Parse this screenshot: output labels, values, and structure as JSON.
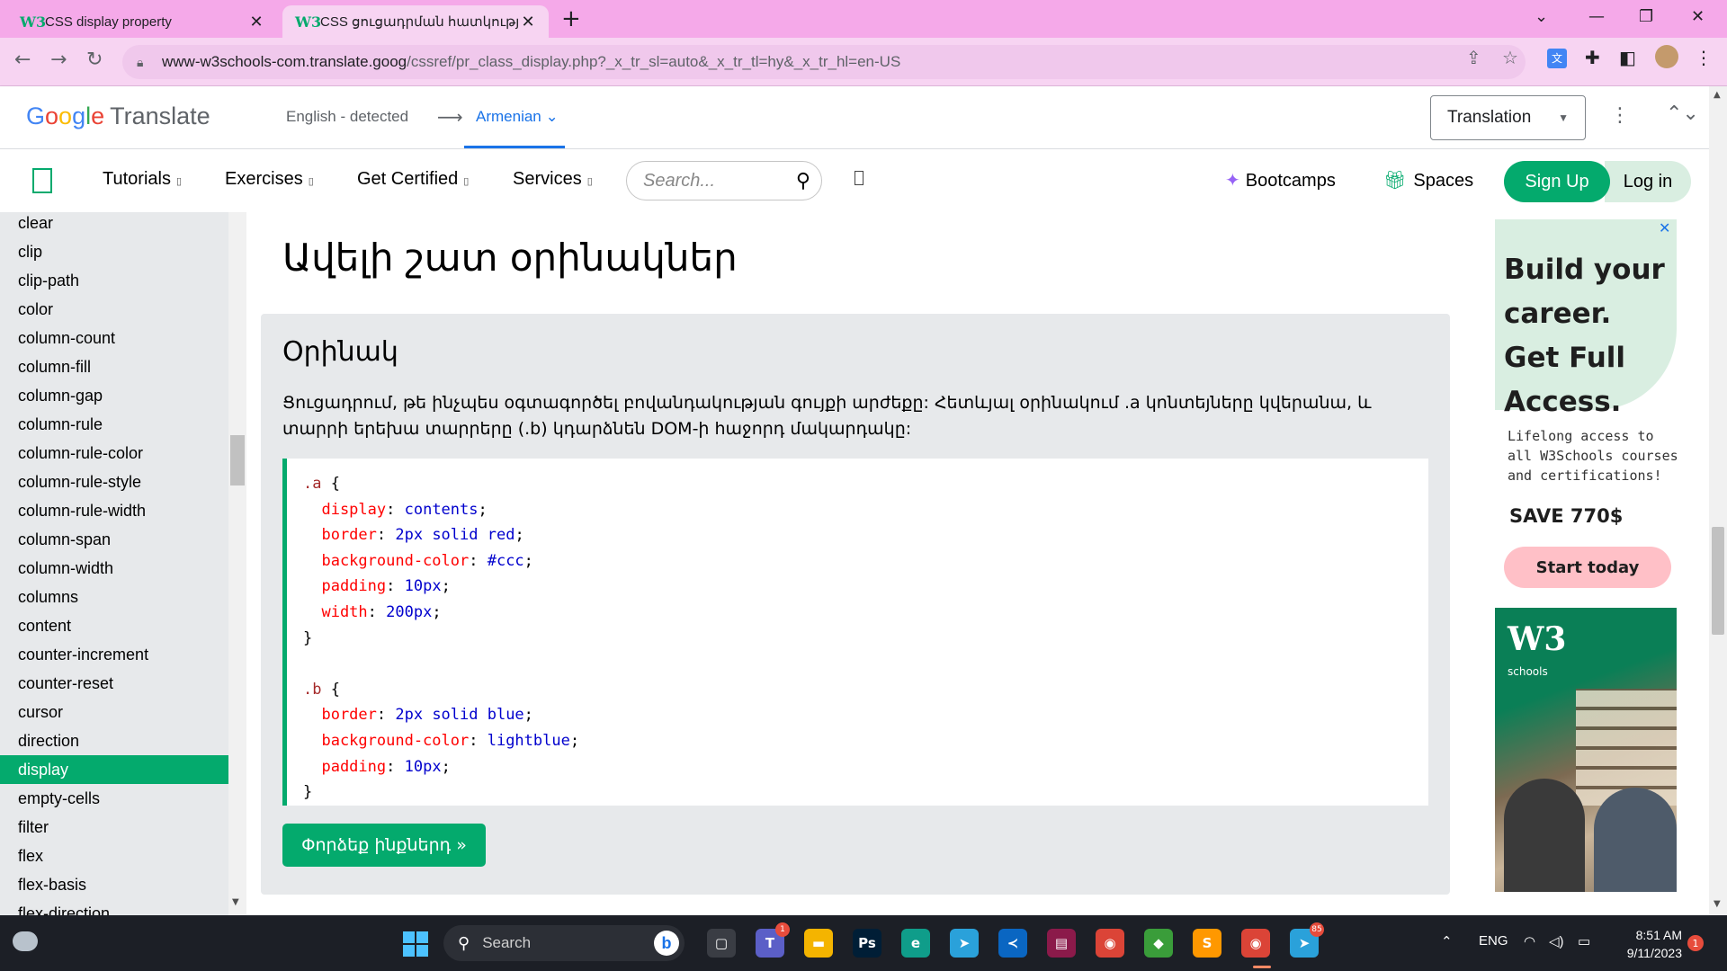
{
  "browser": {
    "tabs": [
      {
        "title": "CSS display property",
        "favicon": "W3",
        "active": false
      },
      {
        "title": "CSS ցուցադրման հատկություն",
        "favicon": "W3",
        "active": true
      }
    ],
    "new_tab": "+",
    "window_controls": {
      "dropdown": "⌄",
      "minimize": "—",
      "restore": "❐",
      "close": "✕"
    },
    "url_host": "www-w3schools-com.translate.goog",
    "url_path": "/cssref/pr_class_display.php?_x_tr_sl=auto&_x_tr_tl=hy&_x_tr_hl=en-US",
    "nav": {
      "back": "←",
      "forward": "→",
      "reload": "↻"
    }
  },
  "google_translate": {
    "logo": {
      "g1": "G",
      "g2": "o",
      "g3": "o",
      "g4": "g",
      "g5": "l",
      "g6": "e",
      "product": "Translate"
    },
    "source_language": "English - detected",
    "arrow": "⟶",
    "target_language": "Armenian ⌄",
    "mode_select": "Translation",
    "mode_caret": "▼",
    "more": "⋮",
    "close": "⌃⌄"
  },
  "w3nav": {
    "menu": [
      {
        "label": "Tutorials"
      },
      {
        "label": "Exercises"
      },
      {
        "label": "Get Certified"
      },
      {
        "label": "Services"
      }
    ],
    "menu_chevron": "▯",
    "search_placeholder": "Search...",
    "search_icon": "⚲",
    "bootcamps": "Bootcamps",
    "spaces": "Spaces",
    "sign_up": "Sign Up",
    "log_in": "Log in"
  },
  "sidebar": {
    "items": [
      {
        "label": "clear",
        "active": false
      },
      {
        "label": "clip",
        "active": false
      },
      {
        "label": "clip-path",
        "active": false
      },
      {
        "label": "color",
        "active": false
      },
      {
        "label": "column-count",
        "active": false
      },
      {
        "label": "column-fill",
        "active": false
      },
      {
        "label": "column-gap",
        "active": false
      },
      {
        "label": "column-rule",
        "active": false
      },
      {
        "label": "column-rule-color",
        "active": false
      },
      {
        "label": "column-rule-style",
        "active": false
      },
      {
        "label": "column-rule-width",
        "active": false
      },
      {
        "label": "column-span",
        "active": false
      },
      {
        "label": "column-width",
        "active": false
      },
      {
        "label": "columns",
        "active": false
      },
      {
        "label": "content",
        "active": false
      },
      {
        "label": "counter-increment",
        "active": false
      },
      {
        "label": "counter-reset",
        "active": false
      },
      {
        "label": "cursor",
        "active": false
      },
      {
        "label": "direction",
        "active": false
      },
      {
        "label": "display",
        "active": true
      },
      {
        "label": "empty-cells",
        "active": false
      },
      {
        "label": "filter",
        "active": false
      },
      {
        "label": "flex",
        "active": false
      },
      {
        "label": "flex-basis",
        "active": false
      },
      {
        "label": "flex-direction",
        "active": false
      }
    ]
  },
  "main": {
    "heading": "Ավելի շատ օրինակներ",
    "example": {
      "title": "Օրինակ",
      "description": "Ցուցադրում, թե ինչպես օգտագործել բովանդակության գույքի արժեքը: Հետևյալ օրինակում .a կոնտեյները կվերանա, և տարրի երեխա տարրերը (.b) կդարձնեն DOM-ի հաջորդ մակարդակը:",
      "code": [
        [
          {
            "t": ".a",
            "c": "sel"
          },
          {
            "t": " {",
            "c": "plain"
          }
        ],
        [
          {
            "t": "  display",
            "c": "prop"
          },
          {
            "t": ": ",
            "c": "plain"
          },
          {
            "t": "contents",
            "c": "val"
          },
          {
            "t": ";",
            "c": "plain"
          }
        ],
        [
          {
            "t": "  border",
            "c": "prop"
          },
          {
            "t": ": ",
            "c": "plain"
          },
          {
            "t": "2px solid red",
            "c": "val"
          },
          {
            "t": ";",
            "c": "plain"
          }
        ],
        [
          {
            "t": "  background-color",
            "c": "prop"
          },
          {
            "t": ": ",
            "c": "plain"
          },
          {
            "t": "#ccc",
            "c": "val"
          },
          {
            "t": ";",
            "c": "plain"
          }
        ],
        [
          {
            "t": "  padding",
            "c": "prop"
          },
          {
            "t": ": ",
            "c": "plain"
          },
          {
            "t": "10px",
            "c": "val"
          },
          {
            "t": ";",
            "c": "plain"
          }
        ],
        [
          {
            "t": "  width",
            "c": "prop"
          },
          {
            "t": ": ",
            "c": "plain"
          },
          {
            "t": "200px",
            "c": "val"
          },
          {
            "t": ";",
            "c": "plain"
          }
        ],
        [
          {
            "t": "}",
            "c": "plain"
          }
        ],
        [
          {
            "t": "",
            "c": "plain"
          }
        ],
        [
          {
            "t": ".b",
            "c": "sel"
          },
          {
            "t": " {",
            "c": "plain"
          }
        ],
        [
          {
            "t": "  border",
            "c": "prop"
          },
          {
            "t": ": ",
            "c": "plain"
          },
          {
            "t": "2px solid blue",
            "c": "val"
          },
          {
            "t": ";",
            "c": "plain"
          }
        ],
        [
          {
            "t": "  background-color",
            "c": "prop"
          },
          {
            "t": ": ",
            "c": "plain"
          },
          {
            "t": "lightblue",
            "c": "val"
          },
          {
            "t": ";",
            "c": "plain"
          }
        ],
        [
          {
            "t": "  padding",
            "c": "prop"
          },
          {
            "t": ": ",
            "c": "plain"
          },
          {
            "t": "10px",
            "c": "val"
          },
          {
            "t": ";",
            "c": "plain"
          }
        ],
        [
          {
            "t": "}",
            "c": "plain"
          }
        ]
      ],
      "try_button": "Փորձեք ինքներդ »"
    }
  },
  "ad": {
    "close": "✕",
    "headline": "Build your career. Get Full Access.",
    "sub": "Lifelong access to all W3Schools courses and certifications!",
    "save": "SAVE 770$",
    "cta": "Start today",
    "photo_logo": "W3",
    "photo_sub": "schools"
  },
  "taskbar": {
    "search_label": "Search",
    "search_icon": "⚲",
    "bing": "b",
    "apps": [
      {
        "name": "task-view",
        "glyph": "▢",
        "bg": "#3a3d44"
      },
      {
        "name": "teams",
        "glyph": "T",
        "bg": "#5b5fc7",
        "badge": "1"
      },
      {
        "name": "file-explorer",
        "glyph": "▬",
        "bg": "#f4b400"
      },
      {
        "name": "photoshop",
        "glyph": "Ps",
        "bg": "#001e36"
      },
      {
        "name": "edge",
        "glyph": "e",
        "bg": "#0f9d8a"
      },
      {
        "name": "telegram",
        "glyph": "➤",
        "bg": "#2aa1da"
      },
      {
        "name": "vscode",
        "glyph": "≺",
        "bg": "#0a66c2"
      },
      {
        "name": "winrar",
        "glyph": "▤",
        "bg": "#8b1a4a"
      },
      {
        "name": "chrome",
        "glyph": "◉",
        "bg": "#db4437"
      },
      {
        "name": "git",
        "glyph": "◆",
        "bg": "#3a9d3a"
      },
      {
        "name": "sublime",
        "glyph": "S",
        "bg": "#ff9800"
      },
      {
        "name": "chrome-profile",
        "glyph": "◉",
        "bg": "#db4437"
      },
      {
        "name": "telegram-2",
        "glyph": "➤",
        "bg": "#2aa1da",
        "badge": "85"
      }
    ],
    "tray_up": "⌃",
    "language": "ENG",
    "wifi": "◠",
    "volume": "◁)",
    "battery": "▭",
    "time": "8:51 AM",
    "date": "9/11/2023",
    "notifications": "1"
  },
  "colors": {
    "w3_green": "#04aa6d",
    "tab_strip": "#f5a9e9",
    "google_blue": "#1a73e8"
  }
}
